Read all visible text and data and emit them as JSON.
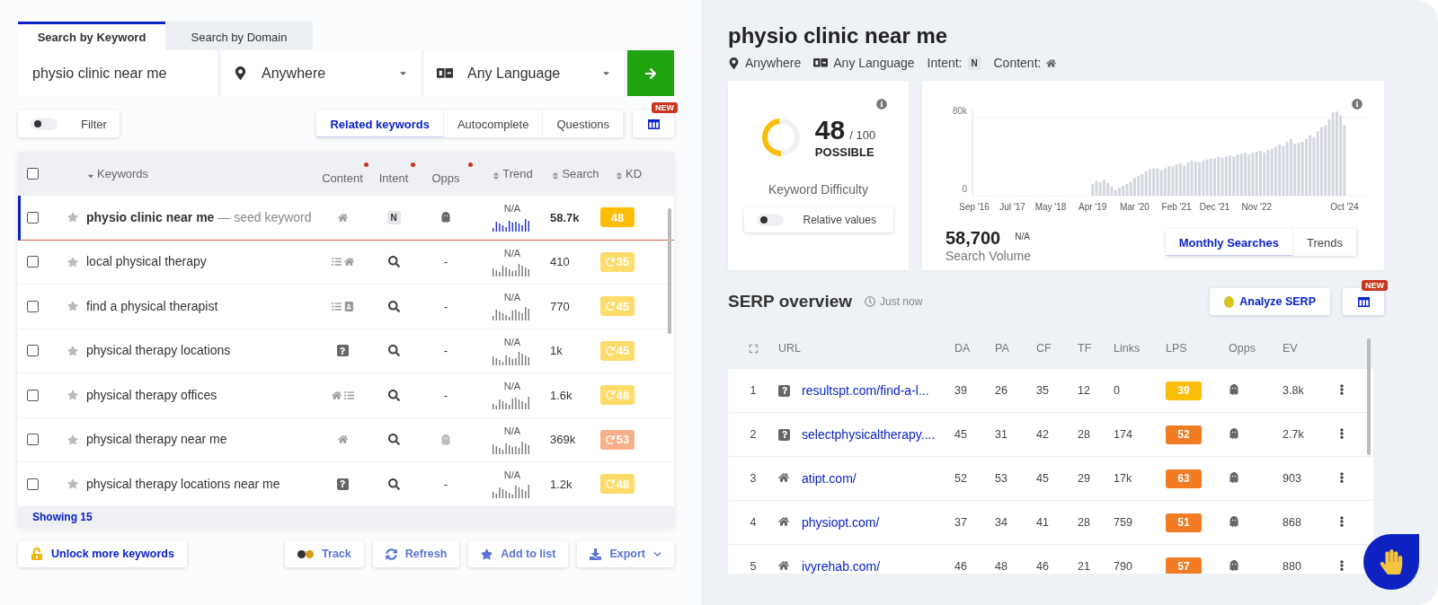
{
  "search_tabs": [
    {
      "label": "Search by Keyword",
      "selected": true
    },
    {
      "label": "Search by Domain",
      "selected": false
    }
  ],
  "search": {
    "value": "physio clinic near me",
    "location": "Anywhere",
    "language": "Any Language"
  },
  "filter": {
    "label": "Filter",
    "on": false
  },
  "mode_tabs": [
    {
      "label": "Related keywords",
      "selected": true
    },
    {
      "label": "Autocomplete",
      "selected": false
    },
    {
      "label": "Questions",
      "selected": false
    }
  ],
  "columns_badge": "NEW",
  "keyword_table": {
    "all_checked": false,
    "columns": [
      {
        "label": "Keywords",
        "kind": "caret",
        "dot": false
      },
      {
        "label": "Content",
        "kind": "plain",
        "dot": true
      },
      {
        "label": "Intent",
        "kind": "plain",
        "dot": true
      },
      {
        "label": "Opps",
        "kind": "plain",
        "dot": true
      },
      {
        "label": "Trend",
        "kind": "sort",
        "dot": false
      },
      {
        "label": "Search",
        "kind": "sort",
        "dot": false
      },
      {
        "label": "KD",
        "kind": "sort",
        "dot": false
      }
    ],
    "rows": [
      {
        "keyword": "physio clinic near me",
        "note": "— seed keyword",
        "selected": true,
        "checked": false,
        "content": [
          {
            "kind": "home"
          }
        ],
        "intent": {
          "kind": "label",
          "text": "N"
        },
        "opps": {
          "kind": "ghost"
        },
        "trend": "N/A",
        "search": "58.7k",
        "kd": {
          "label": "48",
          "color": "#fbbd08"
        },
        "refresh": false
      },
      {
        "keyword": "local physical therapy",
        "selected": false,
        "checked": false,
        "content": [
          {
            "kind": "list"
          },
          {
            "kind": "home"
          }
        ],
        "intent": {
          "kind": "search"
        },
        "opps": {
          "kind": "text",
          "text": "-"
        },
        "trend": "N/A",
        "search": "410",
        "kd": {
          "label": "35",
          "color": "#fddc6c"
        },
        "refresh": true
      },
      {
        "keyword": "find a physical therapist",
        "selected": false,
        "checked": false,
        "content": [
          {
            "kind": "list"
          },
          {
            "kind": "contact"
          }
        ],
        "intent": {
          "kind": "search"
        },
        "opps": {
          "kind": "text",
          "text": "-"
        },
        "trend": "N/A",
        "search": "770",
        "kd": {
          "label": "45",
          "color": "#fddc6c"
        },
        "refresh": true
      },
      {
        "keyword": "physical therapy locations",
        "selected": false,
        "checked": false,
        "content": [
          {
            "kind": "question"
          }
        ],
        "intent": {
          "kind": "search"
        },
        "opps": {
          "kind": "text",
          "text": "-"
        },
        "trend": "N/A",
        "search": "1k",
        "kd": {
          "label": "45",
          "color": "#fddc6c"
        },
        "refresh": true
      },
      {
        "keyword": "physical therapy offices",
        "selected": false,
        "checked": false,
        "content": [
          {
            "kind": "home"
          },
          {
            "kind": "list"
          }
        ],
        "intent": {
          "kind": "search"
        },
        "opps": {
          "kind": "text",
          "text": "-"
        },
        "trend": "N/A",
        "search": "1.6k",
        "kd": {
          "label": "48",
          "color": "#fddc6c"
        },
        "refresh": true
      },
      {
        "keyword": "physical therapy near me",
        "selected": false,
        "checked": false,
        "content": [
          {
            "kind": "home"
          }
        ],
        "intent": {
          "kind": "search"
        },
        "opps": {
          "kind": "ghost"
        },
        "trend": "N/A",
        "search": "369k",
        "kd": {
          "label": "53",
          "color": "#f6b08a"
        },
        "refresh": true
      },
      {
        "keyword": "physical therapy locations near me",
        "selected": false,
        "checked": false,
        "content": [
          {
            "kind": "question"
          }
        ],
        "intent": {
          "kind": "search"
        },
        "opps": {
          "kind": "text",
          "text": "-"
        },
        "trend": "N/A",
        "search": "1.2k",
        "kd": {
          "label": "48",
          "color": "#fddc6c"
        },
        "refresh": true
      }
    ],
    "footer": "Showing 15"
  },
  "actions": [
    {
      "label": "Unlock more keywords",
      "kind": "unlock"
    },
    {
      "label": "Track",
      "kind": "track"
    },
    {
      "label": "Refresh",
      "kind": "refresh"
    },
    {
      "label": "Add to list",
      "kind": "star"
    },
    {
      "label": "Export",
      "kind": "export"
    }
  ],
  "overview": {
    "title": "physio clinic near me",
    "location": "Anywhere",
    "language": "Any Language",
    "intent_label": "Intent:",
    "intent": "N",
    "content_label": "Content:"
  },
  "difficulty": {
    "value": "48",
    "max": "/ 100",
    "level": 0.48,
    "verdict": "POSSIBLE",
    "label": "Keyword Difficulty",
    "toggle": {
      "label": "Relative values",
      "on": false
    }
  },
  "volume": {
    "value": "58,700",
    "change": "N/A",
    "label": "Search Volume",
    "tabs": [
      {
        "label": "Monthly Searches",
        "selected": true
      },
      {
        "label": "Trends",
        "selected": false
      }
    ],
    "chart_data": {
      "type": "bar",
      "categories": [
        "Sep '16",
        null,
        null,
        null,
        null,
        null,
        null,
        null,
        null,
        null,
        "Jul '17",
        null,
        null,
        null,
        null,
        null,
        null,
        null,
        null,
        null,
        "May '18",
        null,
        null,
        null,
        null,
        null,
        null,
        null,
        null,
        null,
        null,
        "Apr '19",
        null,
        null,
        null,
        null,
        null,
        null,
        null,
        null,
        null,
        null,
        "Mar '20",
        null,
        null,
        null,
        null,
        null,
        null,
        null,
        null,
        null,
        null,
        "Feb '21",
        null,
        null,
        null,
        null,
        null,
        null,
        null,
        null,
        null,
        "Dec '21",
        null,
        null,
        null,
        null,
        null,
        null,
        null,
        null,
        null,
        null,
        "Nov '22",
        null,
        null,
        null,
        null,
        null,
        null,
        null,
        null,
        null,
        null,
        null,
        null,
        null,
        null,
        null,
        null,
        null,
        null,
        null,
        null,
        null,
        null,
        "Oct '24"
      ],
      "values": [
        0,
        0,
        0,
        0,
        0,
        0,
        0,
        0,
        0,
        0,
        0,
        0,
        0,
        0,
        0,
        0,
        0,
        0,
        0,
        0,
        0,
        0,
        0,
        0,
        0,
        0,
        0,
        0,
        0,
        0,
        0,
        12000,
        15000,
        14000,
        16000,
        13000,
        9000,
        6000,
        8000,
        10000,
        12000,
        14000,
        18000,
        20000,
        22000,
        25000,
        27000,
        28000,
        28000,
        26000,
        28000,
        30000,
        30000,
        32000,
        33000,
        31000,
        34000,
        36000,
        35000,
        34000,
        36000,
        37000,
        38000,
        38000,
        40000,
        39000,
        40000,
        41000,
        40000,
        42000,
        43000,
        44000,
        42000,
        44000,
        45000,
        46000,
        44000,
        47000,
        48000,
        50000,
        52000,
        51000,
        55000,
        58000,
        53000,
        54000,
        55000,
        58000,
        62000,
        60000,
        66000,
        70000,
        72000,
        78000,
        85000,
        86000,
        82000,
        72000
      ],
      "ylim": [
        0,
        90000
      ],
      "yticks": [
        {
          "value": 0,
          "label": "0"
        },
        {
          "value": 80000,
          "label": "80k"
        }
      ]
    }
  },
  "serp": {
    "title": "SERP overview",
    "updated": "Just now",
    "analyze": "Analyze SERP",
    "badge": "NEW",
    "columns": [
      "URL",
      "DA",
      "PA",
      "CF",
      "TF",
      "Links",
      "LPS",
      "Opps",
      "EV"
    ],
    "rows": [
      {
        "rank": "1",
        "kind": "question",
        "url": "resultspt.com/find-a-l...",
        "da": "39",
        "pa": "26",
        "cf": "35",
        "tf": "12",
        "links": "0",
        "lps": {
          "label": "39",
          "color": "#fbbd08"
        },
        "ev": "3.8k"
      },
      {
        "rank": "2",
        "kind": "question",
        "url": "selectphysicaltherapy....",
        "da": "45",
        "pa": "31",
        "cf": "42",
        "tf": "28",
        "links": "174",
        "lps": {
          "label": "52",
          "color": "#f07b22"
        },
        "ev": "2.7k"
      },
      {
        "rank": "3",
        "kind": "home",
        "url": "atipt.com/",
        "da": "52",
        "pa": "53",
        "cf": "45",
        "tf": "29",
        "links": "17k",
        "lps": {
          "label": "63",
          "color": "#f07b22"
        },
        "ev": "903"
      },
      {
        "rank": "4",
        "kind": "home",
        "url": "physiopt.com/",
        "da": "37",
        "pa": "34",
        "cf": "41",
        "tf": "28",
        "links": "759",
        "lps": {
          "label": "51",
          "color": "#f07b22"
        },
        "ev": "868"
      },
      {
        "rank": "5",
        "kind": "home",
        "url": "ivyrehab.com/",
        "da": "46",
        "pa": "48",
        "cf": "46",
        "tf": "21",
        "links": "790",
        "lps": {
          "label": "57",
          "color": "#f07b22"
        },
        "ev": "880"
      }
    ]
  }
}
